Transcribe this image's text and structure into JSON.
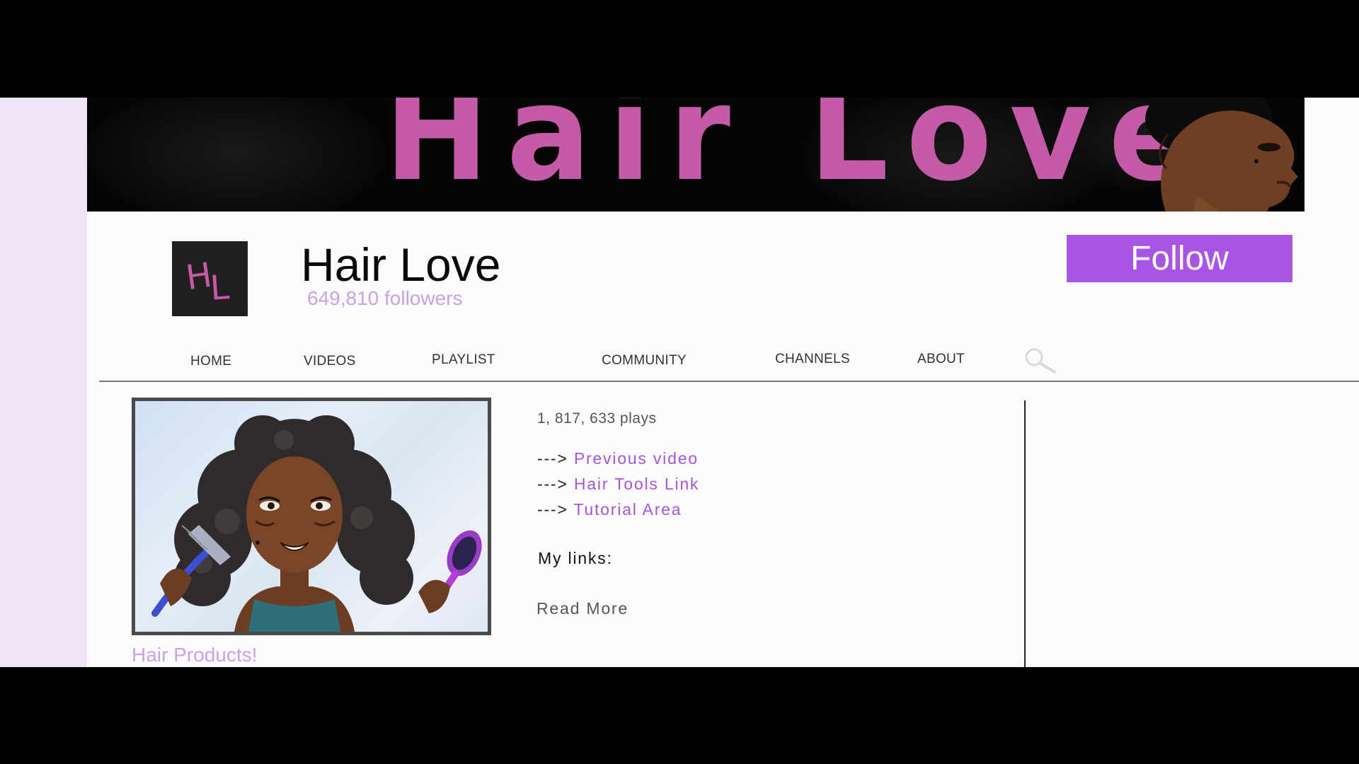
{
  "banner": {
    "title": "Hair Love"
  },
  "channel": {
    "logo_letters": [
      "H",
      "L"
    ],
    "name": "Hair Love",
    "followers": "649,810 followers",
    "follow_label": "Follow"
  },
  "nav": {
    "tabs": [
      {
        "label": "HOME"
      },
      {
        "label": "VIDEOS"
      },
      {
        "label": "PLAYLIST"
      },
      {
        "label": "COMMUNITY"
      },
      {
        "label": "CHANNELS"
      },
      {
        "label": "ABOUT"
      }
    ],
    "search_icon": "search-icon"
  },
  "video": {
    "title": "Hair Products!",
    "plays": "1, 817, 633 plays"
  },
  "description": {
    "links": [
      {
        "arrow": "--->",
        "label": "Previous video"
      },
      {
        "arrow": "--->",
        "label": "Hair Tools Link"
      },
      {
        "arrow": "--->",
        "label": "Tutorial Area"
      }
    ],
    "my_links_label": "My links:",
    "read_more": "Read More"
  },
  "colors": {
    "accent_purple": "#a855e6",
    "banner_pink": "#c45aa8",
    "link_purple": "#a855d9",
    "follower_lavender": "#c9a3e2"
  }
}
